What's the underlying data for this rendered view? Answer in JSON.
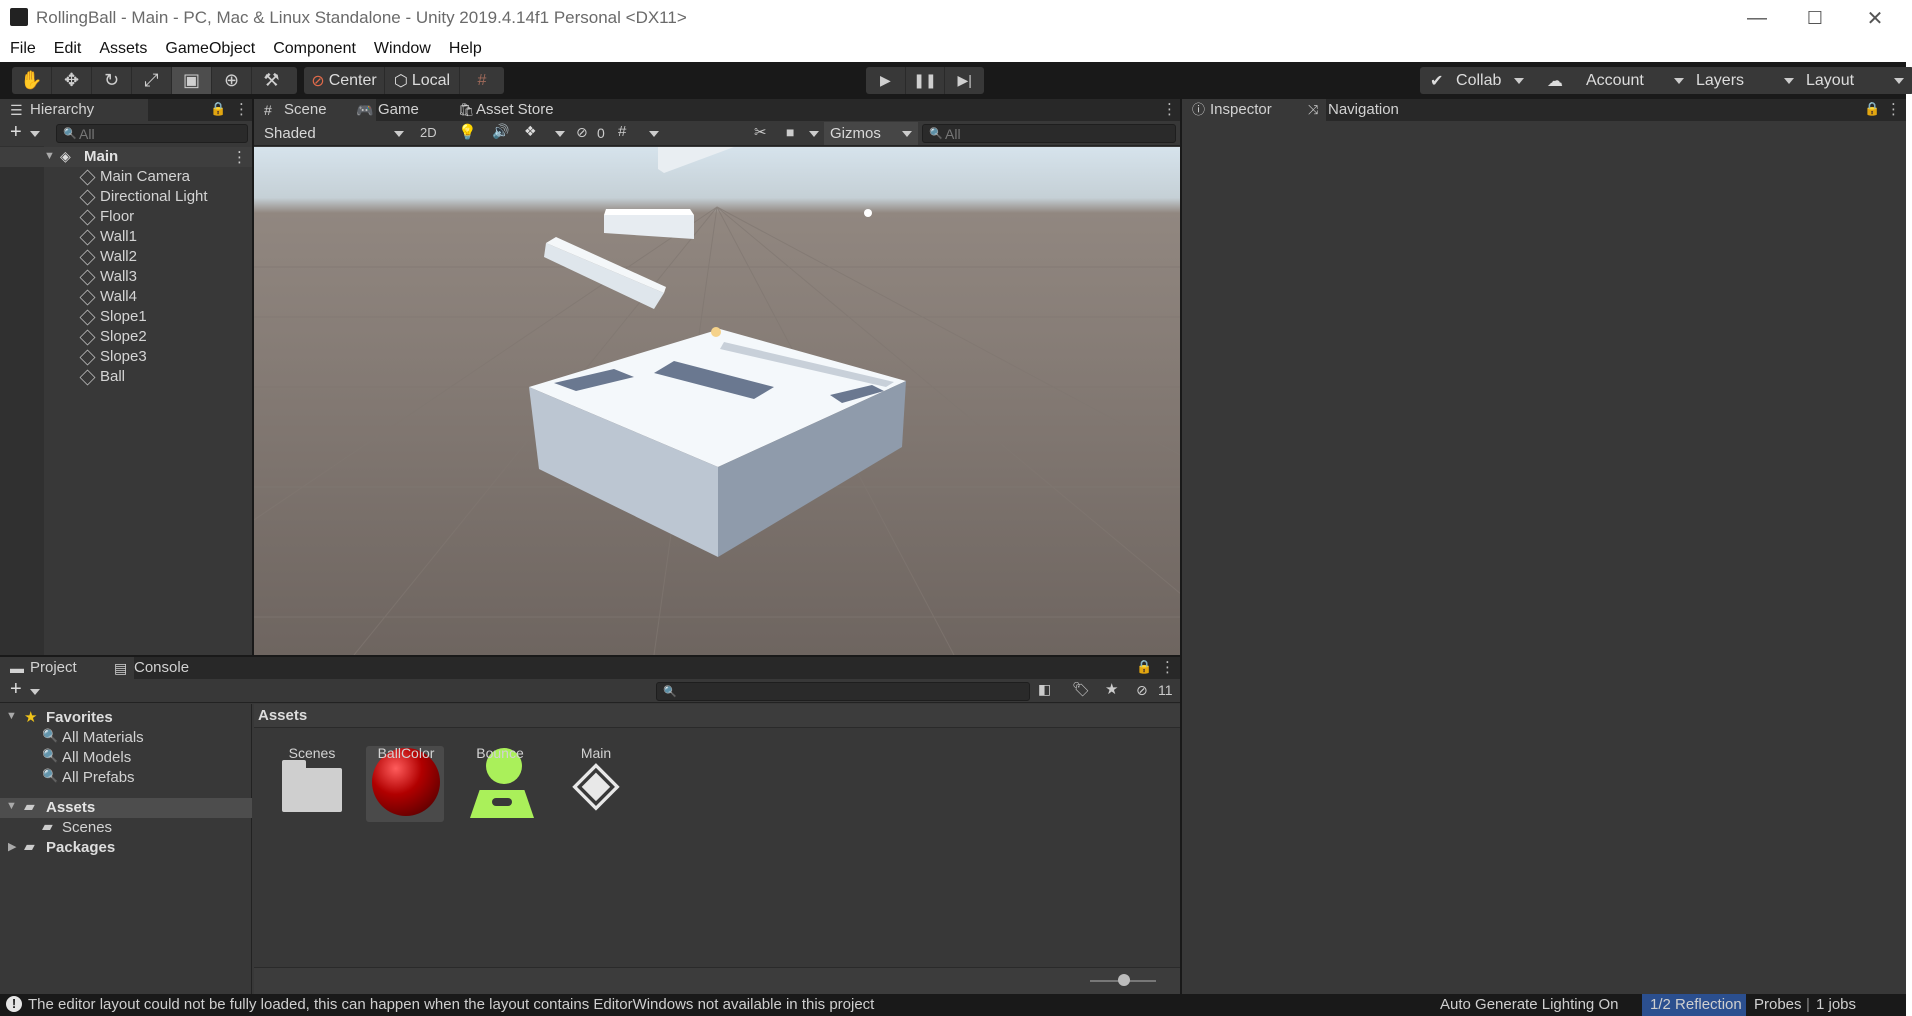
{
  "window": {
    "title": "RollingBall - Main - PC, Mac & Linux Standalone - Unity 2019.4.14f1 Personal <DX11>",
    "minimize": "—",
    "maximize": "☐",
    "close": "✕"
  },
  "menu": [
    "File",
    "Edit",
    "Assets",
    "GameObject",
    "Component",
    "Window",
    "Help"
  ],
  "toolbar": {
    "tools": [
      "hand-icon",
      "move-icon",
      "rotate-icon",
      "scale-icon",
      "rect-icon",
      "transform-icon",
      "custom-tool-icon"
    ],
    "pivot": "Center",
    "space": "Local",
    "collab": "Collab",
    "account": "Account",
    "layers": "Layers",
    "layout": "Layout"
  },
  "hierarchy": {
    "tab": "Hierarchy",
    "search_placeholder": "All",
    "scene": "Main",
    "items": [
      "Main Camera",
      "Directional Light",
      "Floor",
      "Wall1",
      "Wall2",
      "Wall3",
      "Wall4",
      "Slope1",
      "Slope2",
      "Slope3",
      "Ball"
    ]
  },
  "scene_view": {
    "tabs": [
      "Scene",
      "Game",
      "Asset Store"
    ],
    "shading": "Shaded",
    "mode2d": "2D",
    "hidden_count": "0",
    "gizmos": "Gizmos",
    "search_placeholder": "All"
  },
  "inspector": {
    "tabs": [
      "Inspector",
      "Navigation"
    ]
  },
  "project": {
    "tabs": [
      "Project",
      "Console"
    ],
    "favorites_label": "Favorites",
    "favorites": [
      "All Materials",
      "All Models",
      "All Prefabs"
    ],
    "assets_label": "Assets",
    "assets_children": [
      "Scenes"
    ],
    "packages_label": "Packages",
    "breadcrumb": "Assets",
    "hidden_count": "11",
    "items": [
      "Scenes",
      "BallColor",
      "Bounce",
      "Main"
    ]
  },
  "status": {
    "message": "The editor layout could not be fully loaded, this can happen when the layout contains EditorWindows not available in this project",
    "lighting": "Auto Generate Lighting On",
    "probes_highlight": "1/2 Reflection",
    "probes_rest": "Probes",
    "jobs": "1 jobs"
  },
  "colors": {
    "bg": "#191919",
    "panel": "#383838",
    "tab_inactive": "#282828",
    "selection": "#4d4d4d",
    "status_highlight": "#2b4f8f",
    "bounce_green": "#aaf05a"
  }
}
